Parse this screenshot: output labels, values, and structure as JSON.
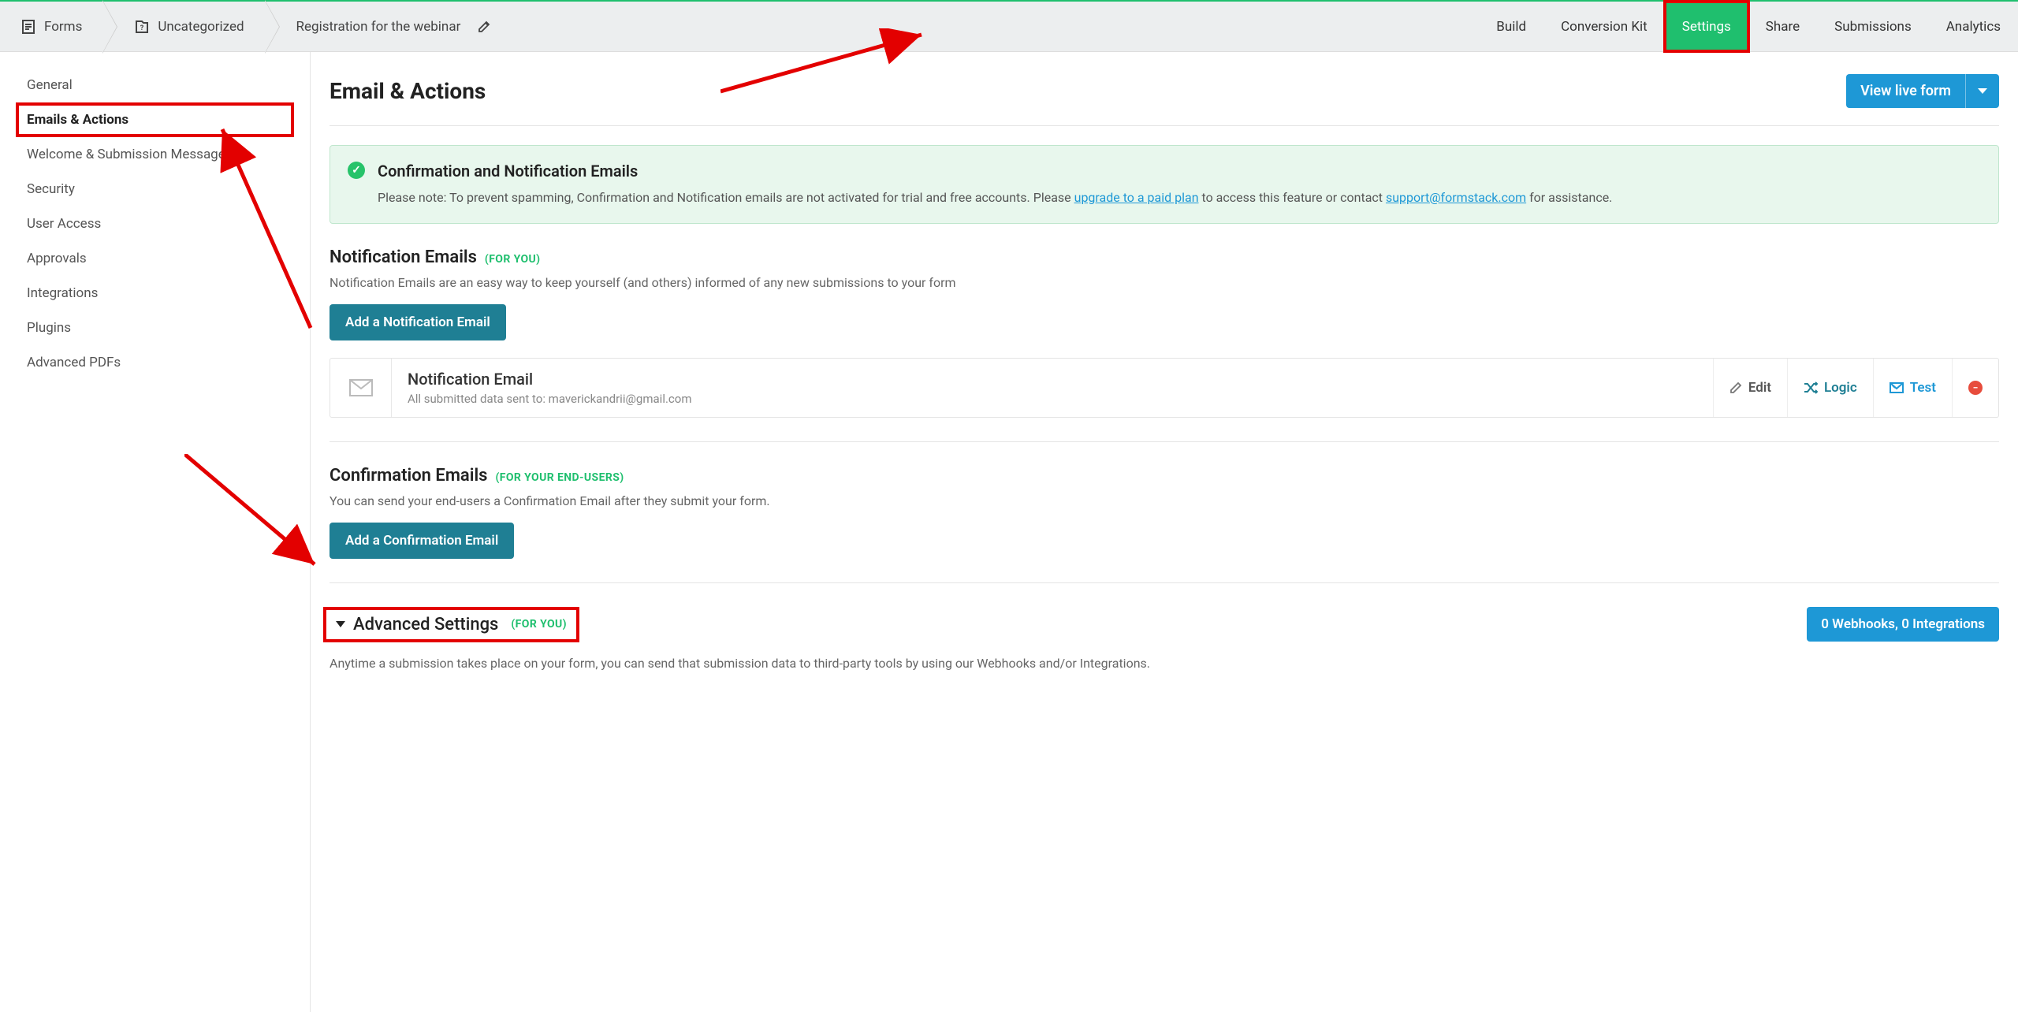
{
  "breadcrumb": {
    "root": "Forms",
    "category": "Uncategorized",
    "form": "Registration for the webinar"
  },
  "topnav": {
    "items": [
      "Build",
      "Conversion Kit",
      "Settings",
      "Share",
      "Submissions",
      "Analytics"
    ],
    "active": "Settings"
  },
  "sidebar": {
    "items": [
      "General",
      "Emails & Actions",
      "Welcome & Submission Message",
      "Security",
      "User Access",
      "Approvals",
      "Integrations",
      "Plugins",
      "Advanced PDFs"
    ],
    "active": "Emails & Actions"
  },
  "main": {
    "title": "Email & Actions",
    "view_live": "View live form"
  },
  "alert": {
    "title": "Confirmation and Notification Emails",
    "text_prefix": "Please note: To prevent spamming, Confirmation and Notification emails are not activated for trial and free accounts. Please ",
    "link1": "upgrade to a paid plan",
    "text_mid": " to access this feature or contact ",
    "link2": "support@formstack.com",
    "text_suffix": " for assistance."
  },
  "notif": {
    "title": "Notification Emails",
    "tag": "(FOR YOU)",
    "desc": "Notification Emails are an easy way to keep yourself (and others) informed of any new submissions to your form",
    "add_btn": "Add a Notification Email",
    "card_title": "Notification Email",
    "card_sub": "All submitted data sent to: maverickandrii@gmail.com",
    "edit": "Edit",
    "logic": "Logic",
    "test": "Test"
  },
  "confirm": {
    "title": "Confirmation Emails",
    "tag": "(FOR YOUR END-USERS)",
    "desc": "You can send your end-users a Confirmation Email after they submit your form.",
    "add_btn": "Add a Confirmation Email"
  },
  "advanced": {
    "title": "Advanced Settings",
    "tag": "(FOR YOU)",
    "summary": "0 Webhooks, 0 Integrations",
    "desc": "Anytime a submission takes place on your form, you can send that submission data to third-party tools by using our Webhooks and/or Integrations."
  }
}
